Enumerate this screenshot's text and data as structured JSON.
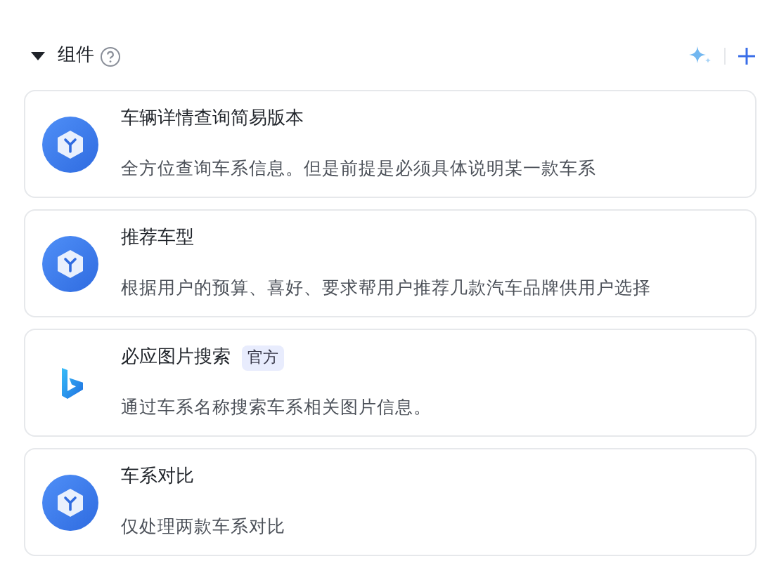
{
  "section": {
    "title": "组件",
    "expanded": true
  },
  "components": [
    {
      "kind": "plugin",
      "name": "车辆详情查询简易版本",
      "description": "全方位查询车系信息。但是前提是必须具体说明某一款车系"
    },
    {
      "kind": "plugin",
      "name": "推荐车型",
      "description": "根据用户的预算、喜好、要求帮用户推荐几款汽车品牌供用户选择"
    },
    {
      "kind": "official",
      "name": "必应图片搜索",
      "badge": "官方",
      "description": "通过车系名称搜索车系相关图片信息。"
    },
    {
      "kind": "plugin",
      "name": "车系对比",
      "description": "仅处理两款车系对比"
    }
  ]
}
